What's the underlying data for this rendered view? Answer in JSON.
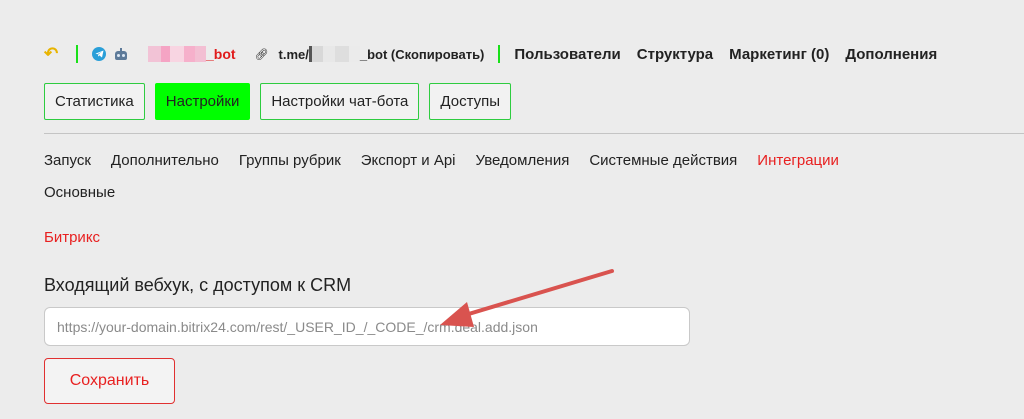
{
  "topbar": {
    "back_icon": "undo-arrow-icon",
    "telegram_icon": "telegram-icon",
    "bot_icon": "robot-icon",
    "bot_name_suffix": "_bot",
    "link_icon": "link-icon",
    "link_prefix": "t.me/",
    "link_suffix": "_bot (Скопировать)",
    "nav": [
      "Пользователи",
      "Структура",
      "Маркетинг (0)",
      "Дополнения"
    ]
  },
  "tabs": [
    {
      "label": "Статистика",
      "active": false
    },
    {
      "label": "Настройки",
      "active": true
    },
    {
      "label": "Настройки чат-бота",
      "active": false
    },
    {
      "label": "Доступы",
      "active": false
    }
  ],
  "subnav": {
    "items": [
      "Запуск",
      "Дополнительно",
      "Группы рубрик",
      "Экспорт и Api",
      "Уведомления",
      "Системные действия",
      "Интеграции"
    ],
    "active": "Интеграции",
    "second_row": "Основные"
  },
  "integration": {
    "section": "Битрикс",
    "field_label": "Входящий вебхук, с доступом к CRM",
    "placeholder": "https://your-domain.bitrix24.com/rest/_USER_ID_/_CODE_/crm.deal.add.json",
    "value": "",
    "save_label": "Сохранить"
  },
  "colors": {
    "accent_green": "#00ff00",
    "accent_red": "#e82020",
    "annotation_arrow": "#d9534f",
    "telegram_blue": "#2a9fd8"
  }
}
